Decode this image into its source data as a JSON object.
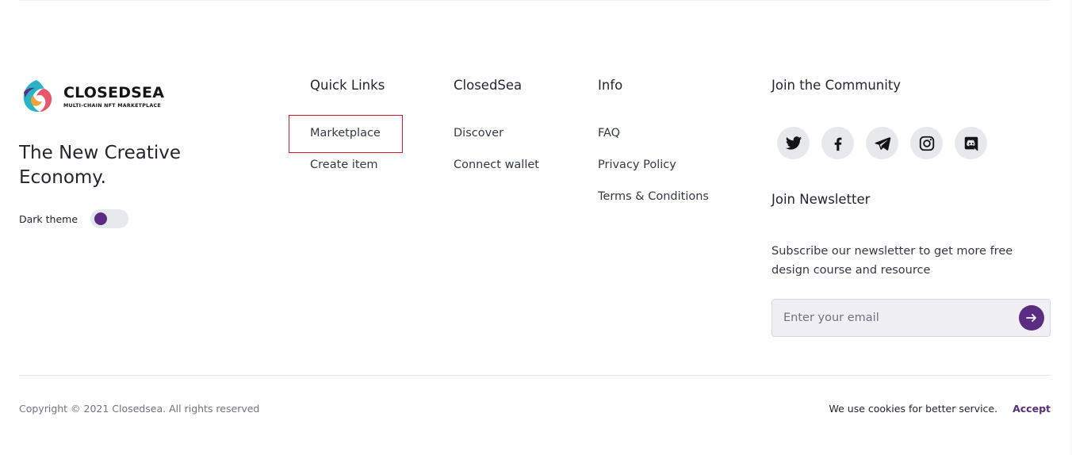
{
  "brand": {
    "name": "CLOSEDSEA",
    "tagline_small": "MULTI-CHAIN NFT MARKETPLACE",
    "slogan": "The New Creative Economy.",
    "theme_label": "Dark theme",
    "accent_color": "#5a2d82"
  },
  "columns": [
    {
      "title": "Quick Links",
      "links": [
        "Marketplace",
        "Create item"
      ]
    },
    {
      "title": "ClosedSea",
      "links": [
        "Discover",
        "Connect wallet"
      ]
    },
    {
      "title": "Info",
      "links": [
        "FAQ",
        "Privacy Policy",
        "Terms & Conditions"
      ]
    }
  ],
  "community": {
    "title": "Join the Community",
    "socials": [
      "twitter-icon",
      "facebook-icon",
      "telegram-icon",
      "instagram-icon",
      "discord-icon"
    ]
  },
  "newsletter": {
    "title": "Join Newsletter",
    "description": "Subscribe our newsletter to get more free design course and resource",
    "placeholder": "Enter your email",
    "submit_icon": "arrow-right-icon"
  },
  "footer": {
    "copyright": "Copyright © 2021 Closedsea. All rights reserved",
    "cookie_text": "We use cookies for better service.",
    "accept_label": "Accept"
  }
}
